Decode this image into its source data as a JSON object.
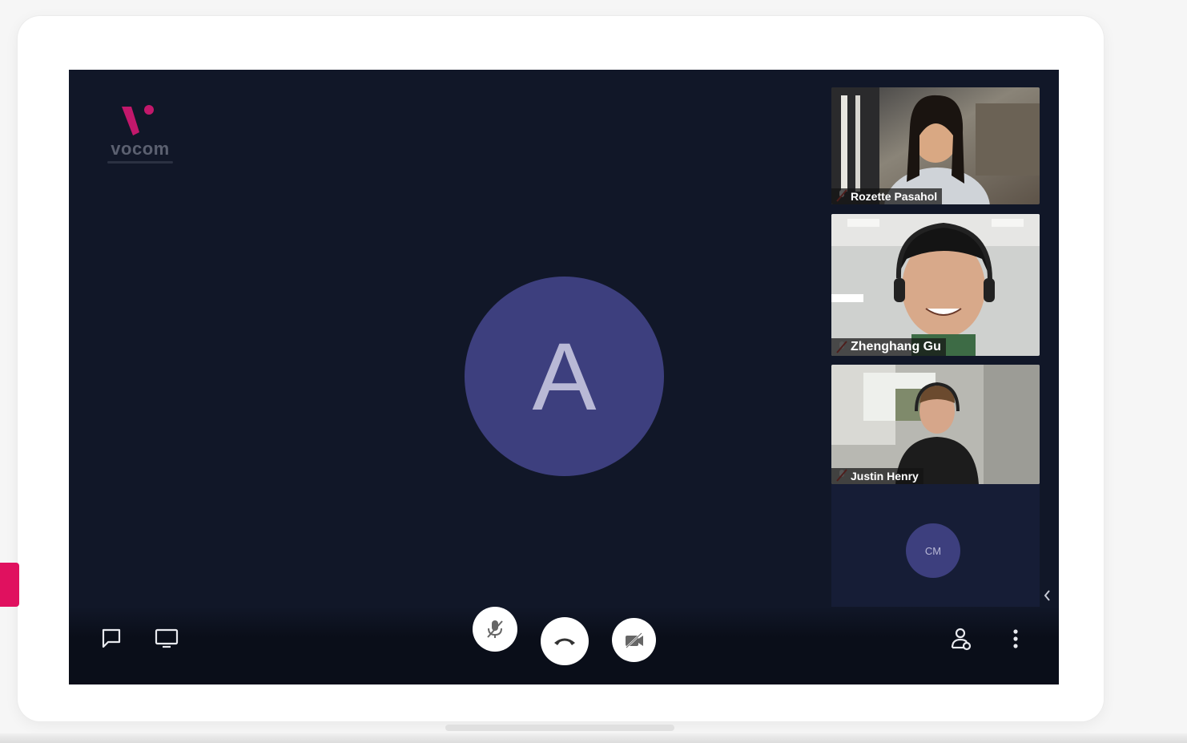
{
  "app": {
    "brand": "vocom",
    "accent_color": "#c2186b",
    "background_color": "#111728"
  },
  "main_participant": {
    "avatar_initial": "A",
    "avatar_color": "#3d3f7e"
  },
  "participants": [
    {
      "name": "Rozette Pasahol",
      "muted": true,
      "icon": "mic-off-icon"
    },
    {
      "name": "Zhenghang Gu",
      "muted": true,
      "icon": "mic-off-icon"
    },
    {
      "name": "Justin Henry",
      "muted": true,
      "icon": "mic-off-icon"
    },
    {
      "initials": "CM",
      "avatar_color": "#3d3f7e"
    }
  ],
  "toolbar": {
    "left": [
      "chat-icon",
      "screen-share-icon"
    ],
    "center": [
      "mic-off-icon",
      "hang-up-icon",
      "camera-off-icon"
    ],
    "right": [
      "participants-icon",
      "more-options-icon"
    ]
  }
}
